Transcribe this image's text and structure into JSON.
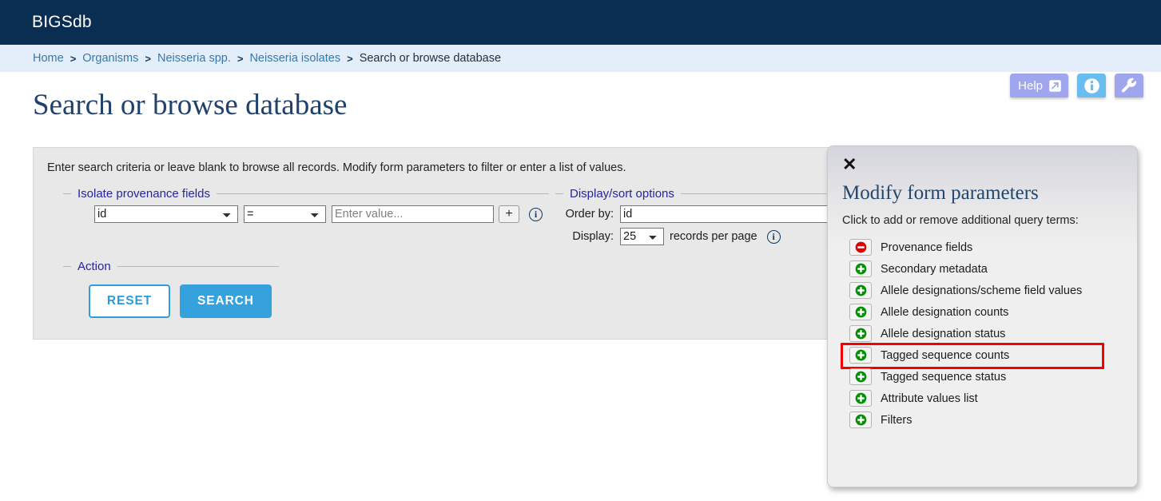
{
  "header": {
    "brand": "BIGSdb"
  },
  "breadcrumb": {
    "items": [
      {
        "label": "Home",
        "current": false
      },
      {
        "label": "Organisms",
        "current": false
      },
      {
        "label": "Neisseria spp.",
        "current": false
      },
      {
        "label": "Neisseria isolates",
        "current": false
      },
      {
        "label": "Search or browse database",
        "current": true
      }
    ],
    "separator": ">"
  },
  "toolbelt": {
    "help_label": "Help",
    "help_icon": "external-link-icon",
    "info_icon": "info-icon",
    "wrench_icon": "wrench-icon",
    "colors": {
      "help_bg": "#a0a6ee",
      "info_bg": "#69bdf0",
      "wrench_bg": "#a0a6ee"
    }
  },
  "page": {
    "title": "Search or browse database"
  },
  "form": {
    "intro": "Enter search criteria or leave blank to browse all records. Modify form parameters to filter or enter a list of values.",
    "provenance": {
      "legend": "Isolate provenance fields",
      "field_value": "id",
      "operator_value": "=",
      "value_placeholder": "Enter value...",
      "value_current": "",
      "add_label": "+",
      "info_glyph": "i"
    },
    "display": {
      "legend": "Display/sort options",
      "order_by_label": "Order by:",
      "order_by_value": "id",
      "display_label": "Display:",
      "records_value": "25",
      "records_unit": "records per page",
      "info_glyph": "i"
    },
    "action": {
      "legend": "Action",
      "reset_label": "RESET",
      "search_label": "SEARCH"
    }
  },
  "modal": {
    "close_glyph": "✕",
    "title": "Modify form parameters",
    "subtitle": "Click to add or remove additional query terms:",
    "items": [
      {
        "label": "Provenance fields",
        "icon": "minus-circle-icon",
        "state": "remove",
        "highlighted": false
      },
      {
        "label": "Secondary metadata",
        "icon": "plus-circle-icon",
        "state": "add",
        "highlighted": false
      },
      {
        "label": "Allele designations/scheme field values",
        "icon": "plus-circle-icon",
        "state": "add",
        "highlighted": false
      },
      {
        "label": "Allele designation counts",
        "icon": "plus-circle-icon",
        "state": "add",
        "highlighted": false
      },
      {
        "label": "Allele designation status",
        "icon": "plus-circle-icon",
        "state": "add",
        "highlighted": false
      },
      {
        "label": "Tagged sequence counts",
        "icon": "plus-circle-icon",
        "state": "add",
        "highlighted": true
      },
      {
        "label": "Tagged sequence status",
        "icon": "plus-circle-icon",
        "state": "add",
        "highlighted": false
      },
      {
        "label": "Attribute values list",
        "icon": "plus-circle-icon",
        "state": "add",
        "highlighted": false
      },
      {
        "label": "Filters",
        "icon": "plus-circle-icon",
        "state": "add",
        "highlighted": false
      }
    ],
    "colors": {
      "add": "#009100",
      "remove": "#e00000",
      "highlight": "#f60000"
    }
  }
}
